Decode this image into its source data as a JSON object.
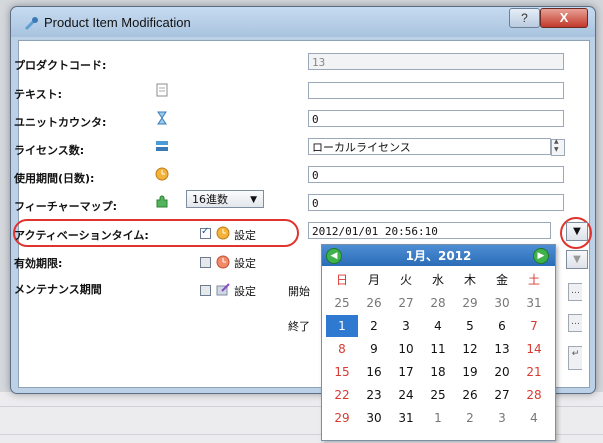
{
  "window": {
    "title": "Product Item Modification",
    "help_label": "?",
    "close_label": "X"
  },
  "fields": [
    {
      "label": "プロダクトコード:",
      "value": "13",
      "disabled": true
    },
    {
      "label": "テキスト:",
      "value": ""
    },
    {
      "label": "ユニットカウンタ:",
      "value": "0"
    },
    {
      "label": "ライセンス数:",
      "value": "ローカルライセンス"
    },
    {
      "label": "使用期間(日数):",
      "value": "0"
    },
    {
      "label": "フィーチャーマップ:",
      "value": "0",
      "select_value": "16進数"
    },
    {
      "label": "アクティベーションタイム:",
      "value": "2012/01/01 20:56:10",
      "checkbox_label": "設定",
      "checked": true
    },
    {
      "label": "有効期限:",
      "value": "",
      "checkbox_label": "設定",
      "checked": false
    },
    {
      "label": "メンテナンス期間",
      "checkbox_label": "設定",
      "checked": false,
      "start_label": "開始",
      "end_label": "終了"
    }
  ],
  "calendar": {
    "title": "1月、2012",
    "prev_icon": "prev-arrow-icon",
    "next_icon": "next-arrow-icon",
    "weekdays": [
      "日",
      "月",
      "火",
      "水",
      "木",
      "金",
      "土"
    ],
    "weeks": [
      [
        25,
        26,
        27,
        28,
        29,
        30,
        31
      ],
      [
        1,
        2,
        3,
        4,
        5,
        6,
        7
      ],
      [
        8,
        9,
        10,
        11,
        12,
        13,
        14
      ],
      [
        15,
        16,
        17,
        18,
        19,
        20,
        21
      ],
      [
        22,
        23,
        24,
        25,
        26,
        27,
        28
      ],
      [
        29,
        30,
        31,
        1,
        2,
        3,
        4
      ]
    ],
    "selected_day": 1,
    "accent_color": "#2f7ad0",
    "weekend_color": "#d83a32"
  },
  "colors": {
    "highlight": "#e0332d"
  }
}
